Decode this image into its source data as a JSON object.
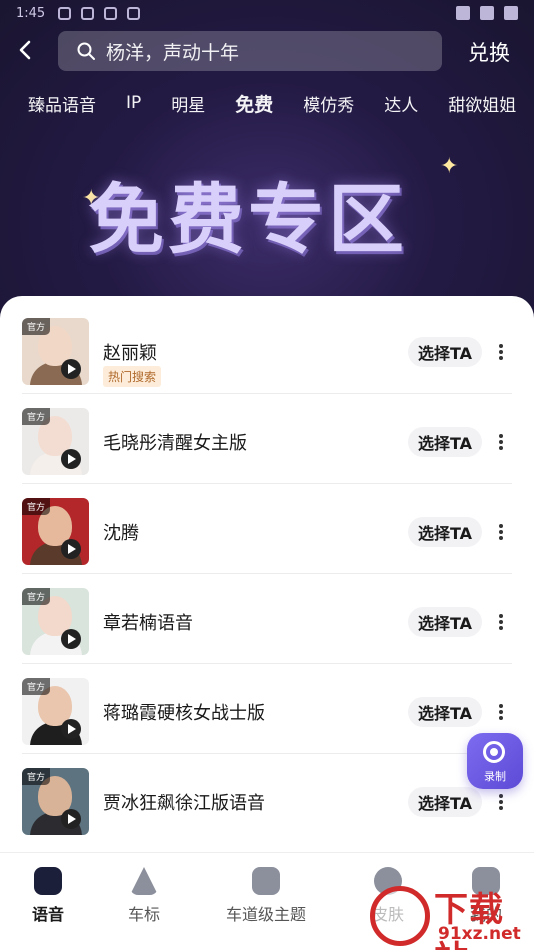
{
  "status_bar": {
    "time": "1:45"
  },
  "header": {
    "search_placeholder": "杨洋，声动十年",
    "redeem_label": "兑换"
  },
  "tabs": [
    {
      "label": "臻品语音"
    },
    {
      "label": "IP"
    },
    {
      "label": "明星"
    },
    {
      "label": "免费"
    },
    {
      "label": "模仿秀"
    },
    {
      "label": "达人"
    },
    {
      "label": "甜欲姐姐"
    }
  ],
  "banner": {
    "title": "免费专区"
  },
  "list": {
    "official_tag": "官方",
    "select_label": "选择TA",
    "items": [
      {
        "name": "赵丽颖",
        "badge": "热门搜索"
      },
      {
        "name": "毛晓彤清醒女主版"
      },
      {
        "name": "沈腾"
      },
      {
        "name": "章若楠语音"
      },
      {
        "name": "蒋璐霞硬核女战士版"
      },
      {
        "name": "贾冰狂飙徐江版语音"
      }
    ]
  },
  "record_button": {
    "label": "录制"
  },
  "bottom_nav": [
    {
      "label": "语音",
      "icon": "voice-icon"
    },
    {
      "label": "车标",
      "icon": "car-logo-icon"
    },
    {
      "label": "车道级主题",
      "icon": "lane-theme-icon"
    },
    {
      "label": "皮肤",
      "icon": "skin-icon"
    },
    {
      "label": "我的",
      "icon": "profile-icon"
    }
  ],
  "watermark": {
    "text": "下载站",
    "url": "91xz.net"
  },
  "colors": {
    "accent": "#5d4ad6",
    "hero_bg": "#231a44",
    "hot_badge_bg": "#fdecd9",
    "hot_badge_text": "#b06a2c"
  }
}
